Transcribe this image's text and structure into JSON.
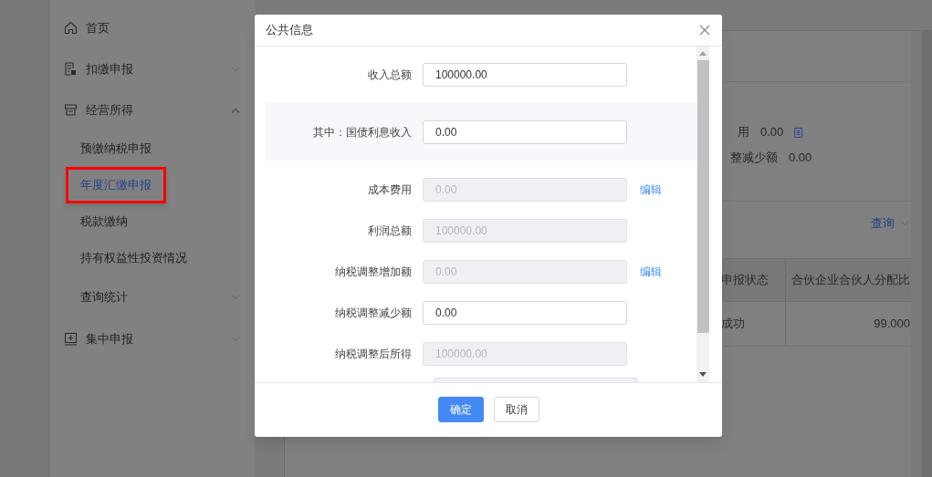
{
  "sidebar": {
    "items": [
      {
        "label": "首页"
      },
      {
        "label": "扣缴申报",
        "expanded": false
      },
      {
        "label": "经营所得",
        "expanded": true,
        "children": [
          {
            "label": "预缴纳税申报",
            "selected": false,
            "highlighted": false
          },
          {
            "label": "年度汇缴申报",
            "selected": true,
            "highlighted": true
          },
          {
            "label": "税款缴纳",
            "selected": false,
            "highlighted": false
          },
          {
            "label": "持有权益性投资情况",
            "selected": false,
            "highlighted": false
          },
          {
            "label": "查询统计",
            "selected": false,
            "highlighted": false,
            "expanded": false
          }
        ]
      },
      {
        "label": "集中申报",
        "expanded": false
      }
    ]
  },
  "background": {
    "summary": [
      {
        "label": "用",
        "value": "0.00",
        "has_icon": true
      },
      {
        "label": "整减少额",
        "value": "0.00",
        "has_icon": false
      }
    ],
    "query_link": "查询",
    "table": {
      "columns": [
        "申报状态",
        "合伙企业合伙人分配比"
      ],
      "rows": [
        [
          "成功",
          "99.000"
        ]
      ]
    }
  },
  "dialog": {
    "title": "公共信息",
    "fields": [
      {
        "label": "收入总额",
        "value": "100000.00",
        "disabled": false,
        "shaded": false
      },
      {
        "label": "其中：国债利息收入",
        "value": "0.00",
        "disabled": false,
        "shaded": true
      },
      {
        "label": "成本费用",
        "value": "0.00",
        "disabled": true,
        "shaded": false,
        "action": "编辑"
      },
      {
        "label": "利润总额",
        "value": "100000.00",
        "disabled": true,
        "shaded": false
      },
      {
        "label": "纳税调整增加额",
        "value": "0.00",
        "disabled": true,
        "shaded": false,
        "action": "编辑"
      },
      {
        "label": "纳税调整减少额",
        "value": "0.00",
        "disabled": false,
        "shaded": false
      },
      {
        "label": "纳税调整后所得",
        "value": "100000.00",
        "disabled": true,
        "shaded": false
      }
    ],
    "buttons": [
      {
        "label": "确定",
        "kind": "primary"
      },
      {
        "label": "取消",
        "kind": "default"
      }
    ]
  }
}
